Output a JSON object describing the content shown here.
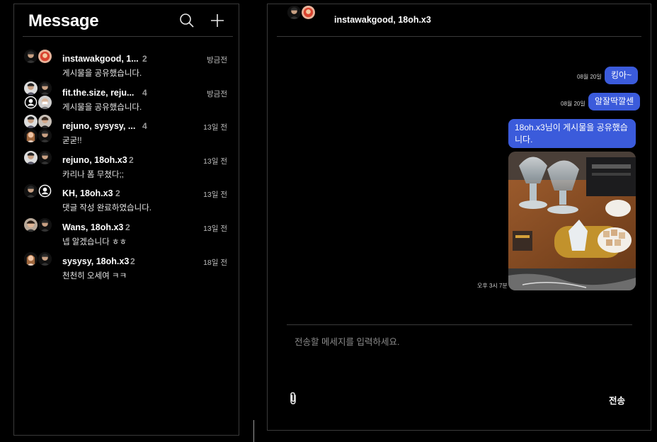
{
  "sidebar": {
    "title": "Message",
    "icons": {
      "search": "search-icon",
      "new": "plus-icon"
    },
    "conversations": [
      {
        "name": "instawakgood, 1...",
        "count": "2",
        "time": "방금전",
        "message": "게시물을 공유했습니다."
      },
      {
        "name": "fit.the.size, reju...",
        "count": "4",
        "time": "방금전",
        "message": "게시물을 공유했습니다."
      },
      {
        "name": "rejuno, sysysy, ...",
        "count": "4",
        "time": "13일 전",
        "message": "굳굳!!"
      },
      {
        "name": "rejuno, 18oh.x3",
        "count": "2",
        "time": "13일 전",
        "message": "카리나 폼 무쳤다;;"
      },
      {
        "name": "KH, 18oh.x3",
        "count": "2",
        "time": "13일 전",
        "message": "댓글 작성 완료하였습니다."
      },
      {
        "name": "Wans, 18oh.x3",
        "count": "2",
        "time": "13일 전",
        "message": "넵 알겠습니다 ㅎㅎ"
      },
      {
        "name": "sysysy, 18oh.x3",
        "count": "2",
        "time": "18일 전",
        "message": "천천히 오세여 ㅋㅋ"
      }
    ]
  },
  "chat": {
    "title": "instawakgood, 18oh.x3",
    "messages": [
      {
        "text": "킹아~",
        "time": "08월 20일"
      },
      {
        "text": "알잘딱깔센",
        "time": "08월 20일"
      },
      {
        "text": "18oh.x3님이 게시물을 공유했습니다.",
        "time": ""
      }
    ],
    "shared_post_time": "오후 3시 7분",
    "compose": {
      "placeholder": "전송할 메세지를 입력하세요.",
      "value": "",
      "attach_icon": "paperclip-icon",
      "send_label": "전송"
    }
  },
  "colors": {
    "background": "#000000",
    "bubble": "#3b5bdb",
    "border": "#3a3a3a",
    "muted": "#9a9a9a"
  }
}
